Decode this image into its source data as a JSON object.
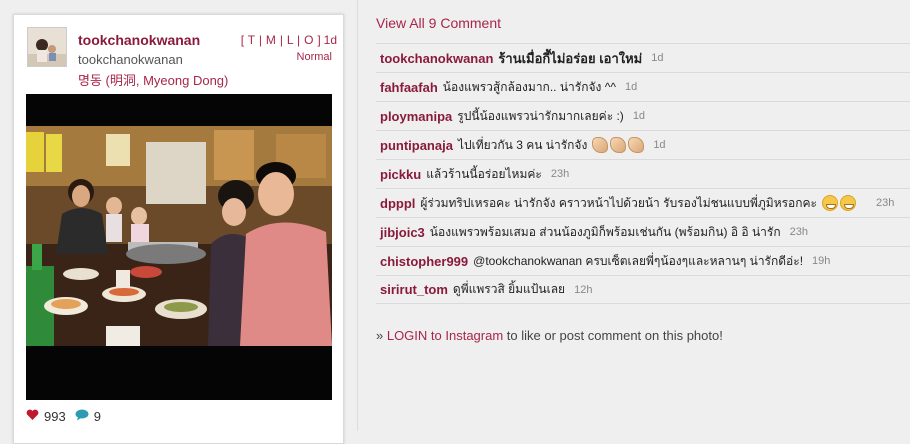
{
  "post": {
    "username": "tookchanokwanan",
    "full_name": "tookchanokwanan",
    "location": "명동 (明洞, Myeong Dong)",
    "filters": "[ T | M | L | O ]",
    "time": "1d",
    "filter_name": "Normal",
    "likes": "993",
    "comments_count": "9"
  },
  "comments_section": {
    "view_all": "View All 9 Comment",
    "items": [
      {
        "user": "tookchanokwanan",
        "text": "ร้านเมื่อกี้ไม่อร่อย เอาใหม่",
        "time": "1d",
        "bold": true
      },
      {
        "user": "fahfaafah",
        "text": "น้องแพรวสู้กล้องมาก.. น่ารักจัง ^^",
        "time": "1d"
      },
      {
        "user": "ploymanipa",
        "text": "รูปนี้น้องแพรวน่ารักมากเลยค่ะ :)",
        "time": "1d"
      },
      {
        "user": "puntipanaja",
        "text": "ไปเที่ยวกัน 3 คน น่ารักจัง",
        "time": "1d",
        "claps": 3
      },
      {
        "user": "pickku",
        "text": "แล้วร้านนี้อร่อยไหมค่ะ",
        "time": "23h"
      },
      {
        "user": "dpppl",
        "text": "ผู้ร่วมทริปเหรอคะ น่ารักจัง คราวหน้าไปด้วยน้า รับรองไม่ชนแบบพี่ภูมิหรอกคะ",
        "time": "23h",
        "emojis": 2
      },
      {
        "user": "jibjoic3",
        "text": "น้องแพรวพร้อมเสมอ ส่วนน้องภูมิก็พร้อมเช่นกัน (พร้อมกิน) อิ อิ น่ารัก",
        "time": "23h"
      },
      {
        "user": "chistopher999",
        "text": "@tookchanokwanan ครบเซ็ตเลยพี่ๆน้องๆและหลานๆ น่ารักดีอ่ะ!",
        "time": "19h"
      },
      {
        "user": "sirirut_tom",
        "text": "ดูพี่แพรวสิ ยิ้มแป้นเลย",
        "time": "12h"
      }
    ]
  },
  "login": {
    "prefix": "» ",
    "link": "LOGIN to Instagram",
    "suffix": " to like or post comment on this photo!"
  },
  "colors": {
    "accent": "#a8264a",
    "username": "#8a1a3c",
    "heart": "#c0182f",
    "comment_bubble": "#2e9bb3"
  }
}
